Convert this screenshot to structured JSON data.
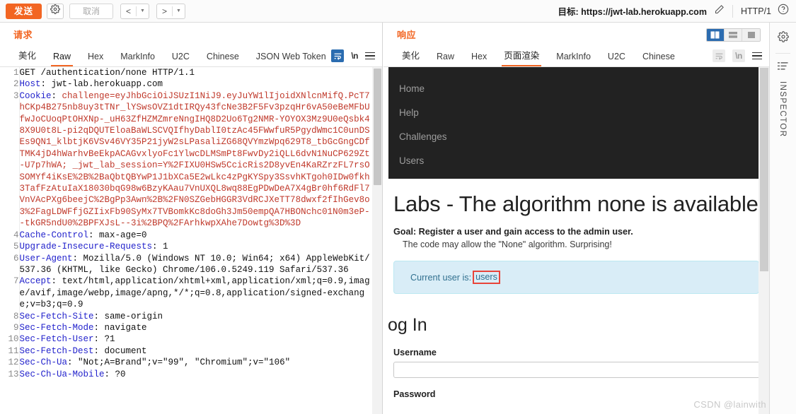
{
  "topbar": {
    "send_label": "发送",
    "settings_icon": "gear-icon",
    "cancel_label": "取消",
    "back_icon": "chevron-left-icon",
    "forward_icon": "chevron-right-icon",
    "caret_icon": "caret-down-icon",
    "target_label": "目标: https://jwt-lab.herokuapp.com",
    "edit_icon": "pencil-icon",
    "http_version": "HTTP/1",
    "help_icon": "question-circle-icon"
  },
  "request_panel": {
    "title": "请求",
    "tabs": [
      {
        "label": "美化",
        "active": false
      },
      {
        "label": "Raw",
        "active": true
      },
      {
        "label": "Hex",
        "active": false
      },
      {
        "label": "MarkInfo",
        "active": false
      },
      {
        "label": "U2C",
        "active": false
      },
      {
        "label": "Chinese",
        "active": false
      },
      {
        "label": "JSON Web Token",
        "active": false
      }
    ],
    "icons": [
      {
        "name": "wrap-lines-icon",
        "state": "active"
      },
      {
        "name": "newline-icon",
        "label": "\\n",
        "state": "normal"
      },
      {
        "name": "menu-icon",
        "state": "normal"
      }
    ],
    "lines": [
      {
        "n": "1",
        "parts": [
          {
            "t": "GET /authentication/none HTTP/1.1",
            "c": "plain"
          }
        ]
      },
      {
        "n": "2",
        "parts": [
          {
            "t": "Host",
            "c": "key"
          },
          {
            "t": ": jwt-lab.herokuapp.com",
            "c": "plain"
          }
        ]
      },
      {
        "n": "3",
        "parts": [
          {
            "t": "Cookie",
            "c": "key"
          },
          {
            "t": ": ",
            "c": "plain"
          },
          {
            "t": "challenge=",
            "c": "keyred"
          },
          {
            "t": "eyJhbGciOiJSUzI1NiJ9.eyJuYW1lIjoidXNlcnMifQ.PcT7hCKp4B275nb8uy3tTNr_lYSwsOVZ1dtIRQy43fcNe3B2F5Fv3pzqHr6vA50eBeMFbUfwJoCUoqPtOHXNp-_uH63ZfHZMZmreNngIHQ8D2Uo6Tg2NMR-YOYOX3Mz9U0eQsbk48X9U0t8L-pi2qDQUTEloaBaWLSCVQIfhyDablI0tzAc45FWwfuR5PgydWmc1C0unDSEs9QN1_klbtjK6VSv46VY35P21jyW2sLPasaliZG68QVYmzWpq629T8_tbGcGngCDfTMK4jD4hWarhvBeEkpACAGvxlyoFc1YlwcDLMSmPt8FwvDy2iQLL6dvN1NuCP629Zt-U7p7hWA; ",
            "c": "red"
          },
          {
            "t": "_jwt_lab_session=",
            "c": "keyred"
          },
          {
            "t": "Y%2FIXU0HSw5CcicRis2D8yvEn4KaRZrzFL7rsOSOMYf4iKsE%2B%2BaQbtQBYwP1J1bXCa5E2wLkc4zPgKYSpy3SsvhKTgoh0IDw0fkh3TafFzAtuIaX18030bqG98w6BzyKAau7VnUXQL8wq88EgPDwDeA7X4gBr0hf6RdFl7VnVAcPXg6beejC%2BgPp3Awn%2B%2FN0SZGebHGGR3VdRCJXeTT78dwxf2fIhGev8o3%2FagLDWFfjGZIixFb90SyMx7TVBomkKc8doGh3Jm50empQA7HBONchc01N0m3eP--tkGR5ndU0%2BPFXJsL--3i%2BPQ%2FArhkwpXAhe7Dowtg%3D%3D",
            "c": "red"
          }
        ]
      },
      {
        "n": "4",
        "parts": [
          {
            "t": "Cache-Control",
            "c": "key"
          },
          {
            "t": ": max-age=0",
            "c": "plain"
          }
        ]
      },
      {
        "n": "5",
        "parts": [
          {
            "t": "Upgrade-Insecure-Requests",
            "c": "key"
          },
          {
            "t": ": 1",
            "c": "plain"
          }
        ]
      },
      {
        "n": "6",
        "parts": [
          {
            "t": "User-Agent",
            "c": "key"
          },
          {
            "t": ": Mozilla/5.0 (Windows NT 10.0; Win64; x64) AppleWebKit/537.36 (KHTML, like Gecko) Chrome/106.0.5249.119 Safari/537.36",
            "c": "plain"
          }
        ]
      },
      {
        "n": "7",
        "parts": [
          {
            "t": "Accept",
            "c": "key"
          },
          {
            "t": ": text/html,application/xhtml+xml,application/xml;q=0.9,image/avif,image/webp,image/apng,*/*;q=0.8,application/signed-exchange;v=b3;q=0.9",
            "c": "plain"
          }
        ]
      },
      {
        "n": "8",
        "parts": [
          {
            "t": "Sec-Fetch-Site",
            "c": "key"
          },
          {
            "t": ": same-origin",
            "c": "plain"
          }
        ]
      },
      {
        "n": "9",
        "parts": [
          {
            "t": "Sec-Fetch-Mode",
            "c": "key"
          },
          {
            "t": ": navigate",
            "c": "plain"
          }
        ]
      },
      {
        "n": "10",
        "parts": [
          {
            "t": "Sec-Fetch-User",
            "c": "key"
          },
          {
            "t": ": ?1",
            "c": "plain"
          }
        ]
      },
      {
        "n": "11",
        "parts": [
          {
            "t": "Sec-Fetch-Dest",
            "c": "key"
          },
          {
            "t": ": document",
            "c": "plain"
          }
        ]
      },
      {
        "n": "12",
        "parts": [
          {
            "t": "Sec-Ch-Ua",
            "c": "key"
          },
          {
            "t": ": \"Not;A=Brand\";v=\"99\", \"Chromium\";v=\"106\"",
            "c": "plain"
          }
        ]
      },
      {
        "n": "13",
        "parts": [
          {
            "t": "Sec-Ch-Ua-Mobile",
            "c": "key"
          },
          {
            "t": ": ?0",
            "c": "plain"
          }
        ]
      }
    ]
  },
  "response_panel": {
    "title": "响应",
    "tabs": [
      {
        "label": "美化",
        "active": false
      },
      {
        "label": "Raw",
        "active": false
      },
      {
        "label": "Hex",
        "active": false
      },
      {
        "label": "页面渲染",
        "active": true
      },
      {
        "label": "MarkInfo",
        "active": false
      },
      {
        "label": "U2C",
        "active": false
      },
      {
        "label": "Chinese",
        "active": false
      }
    ],
    "icons": [
      {
        "name": "wrap-lines-icon",
        "state": "dim"
      },
      {
        "name": "newline-icon",
        "label": "\\n",
        "state": "dim"
      },
      {
        "name": "menu-icon",
        "state": "normal"
      }
    ],
    "layout_buttons": [
      {
        "name": "layout-split-vertical",
        "active": true
      },
      {
        "name": "layout-split-horizontal",
        "active": false
      },
      {
        "name": "layout-single",
        "active": false
      }
    ]
  },
  "rendered_page": {
    "nav_items": [
      "Home",
      "Help",
      "Challenges",
      "Users"
    ],
    "heading": "Labs - The algorithm none is available",
    "goal": "Goal: Register a user and gain access to the admin user.",
    "goal_sub": "The code may allow the \"None\" algorithm. Surprising!",
    "alert_prefix": "Current user is:",
    "alert_user": "users",
    "login_heading": "og In",
    "username_label": "Username",
    "username_value": "",
    "password_label": "Password"
  },
  "inspector": {
    "gear_icon": "gear-icon",
    "lines_icon": "list-icon",
    "label": "INSPECTOR"
  },
  "watermark": "CSDN @lainwith",
  "colors": {
    "accent": "#f26522",
    "blue": "#2b6cb0",
    "highlight_red": "#e8443a",
    "alert_bg": "#d9edf7",
    "nav_bg": "#222222"
  }
}
